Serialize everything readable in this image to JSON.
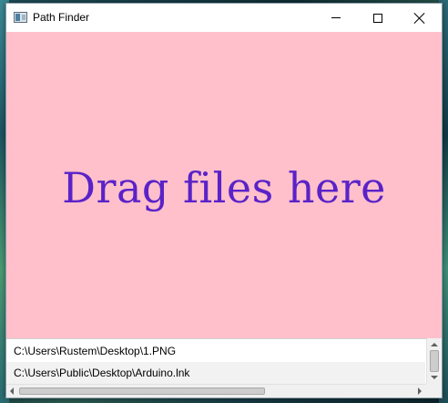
{
  "window": {
    "title": "Path Finder",
    "app_icon": "window-app-icon",
    "controls": {
      "minimize_icon": "minimize-icon",
      "maximize_icon": "maximize-icon",
      "close_icon": "close-icon"
    }
  },
  "drop_zone": {
    "text": "Drag files here",
    "background_color": "#ffc0cb",
    "text_color": "#5a22c8"
  },
  "file_list": {
    "items": [
      "C:\\Users\\Rustem\\Desktop\\1.PNG",
      "C:\\Users\\Public\\Desktop\\Arduino.lnk"
    ]
  }
}
